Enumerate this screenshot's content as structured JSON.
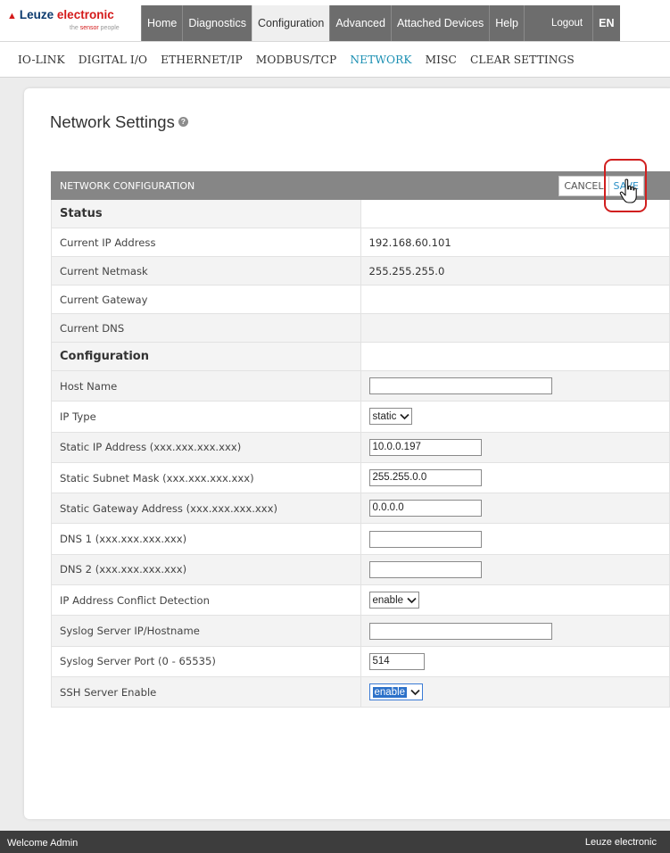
{
  "brand": {
    "name_first": "Leuze",
    "name_second": "electronic",
    "tagline_prefix": "the",
    "tagline_highlight": "sensor",
    "tagline_suffix": "people"
  },
  "main_nav": [
    "Home",
    "Diagnostics",
    "Configuration",
    "Advanced",
    "Attached Devices",
    "Help"
  ],
  "main_nav_active": "Configuration",
  "logout_label": "Logout",
  "language": "EN",
  "sub_nav": [
    "IO-LINK",
    "DIGITAL I/O",
    "ETHERNET/IP",
    "MODBUS/TCP",
    "NETWORK",
    "MISC",
    "CLEAR SETTINGS"
  ],
  "sub_nav_active": "NETWORK",
  "page_title": "Network Settings",
  "help_glyph": "?",
  "panel": {
    "title": "NETWORK CONFIGURATION",
    "cancel_label": "CANCEL",
    "save_label": "SAVE"
  },
  "status": {
    "heading": "Status",
    "rows": [
      {
        "label": "Current IP Address",
        "value": "192.168.60.101"
      },
      {
        "label": "Current Netmask",
        "value": "255.255.255.0"
      },
      {
        "label": "Current Gateway",
        "value": ""
      },
      {
        "label": "Current DNS",
        "value": ""
      }
    ]
  },
  "configuration": {
    "heading": "Configuration",
    "rows": [
      {
        "label": "Host Name",
        "control": "input",
        "value": "",
        "size": "long"
      },
      {
        "label": "IP Type",
        "control": "select",
        "value": "static",
        "active": false
      },
      {
        "label": "Static IP Address (xxx.xxx.xxx.xxx)",
        "control": "input",
        "value": "10.0.0.197",
        "size": "mid"
      },
      {
        "label": "Static Subnet Mask (xxx.xxx.xxx.xxx)",
        "control": "input",
        "value": "255.255.0.0",
        "size": "mid"
      },
      {
        "label": "Static Gateway Address (xxx.xxx.xxx.xxx)",
        "control": "input",
        "value": "0.0.0.0",
        "size": "mid"
      },
      {
        "label": "DNS 1 (xxx.xxx.xxx.xxx)",
        "control": "input",
        "value": "",
        "size": "mid"
      },
      {
        "label": "DNS 2 (xxx.xxx.xxx.xxx)",
        "control": "input",
        "value": "",
        "size": "mid"
      },
      {
        "label": "IP Address Conflict Detection",
        "control": "select",
        "value": "enable",
        "active": false
      },
      {
        "label": "Syslog Server IP/Hostname",
        "control": "input",
        "value": "",
        "size": "long"
      },
      {
        "label": "Syslog Server Port (0 - 65535)",
        "control": "input",
        "value": "514",
        "size": "short"
      },
      {
        "label": "SSH Server Enable",
        "control": "select",
        "value": "enable",
        "active": true
      }
    ]
  },
  "footer": {
    "welcome": "Welcome Admin",
    "company": "Leuze electronic"
  },
  "icons": [
    "warning-triangle-icon",
    "help-icon",
    "chevron-down-icon",
    "hand-cursor-icon"
  ],
  "colors": {
    "nav_bg": "#6d6d6d",
    "accent": "#1a8fb2",
    "brand_red": "#d41a1a",
    "brand_blue": "#0b3a6e",
    "panel_header": "#868686",
    "highlight_ring": "#d11f1f",
    "footer_bg": "#3d3d3d"
  }
}
